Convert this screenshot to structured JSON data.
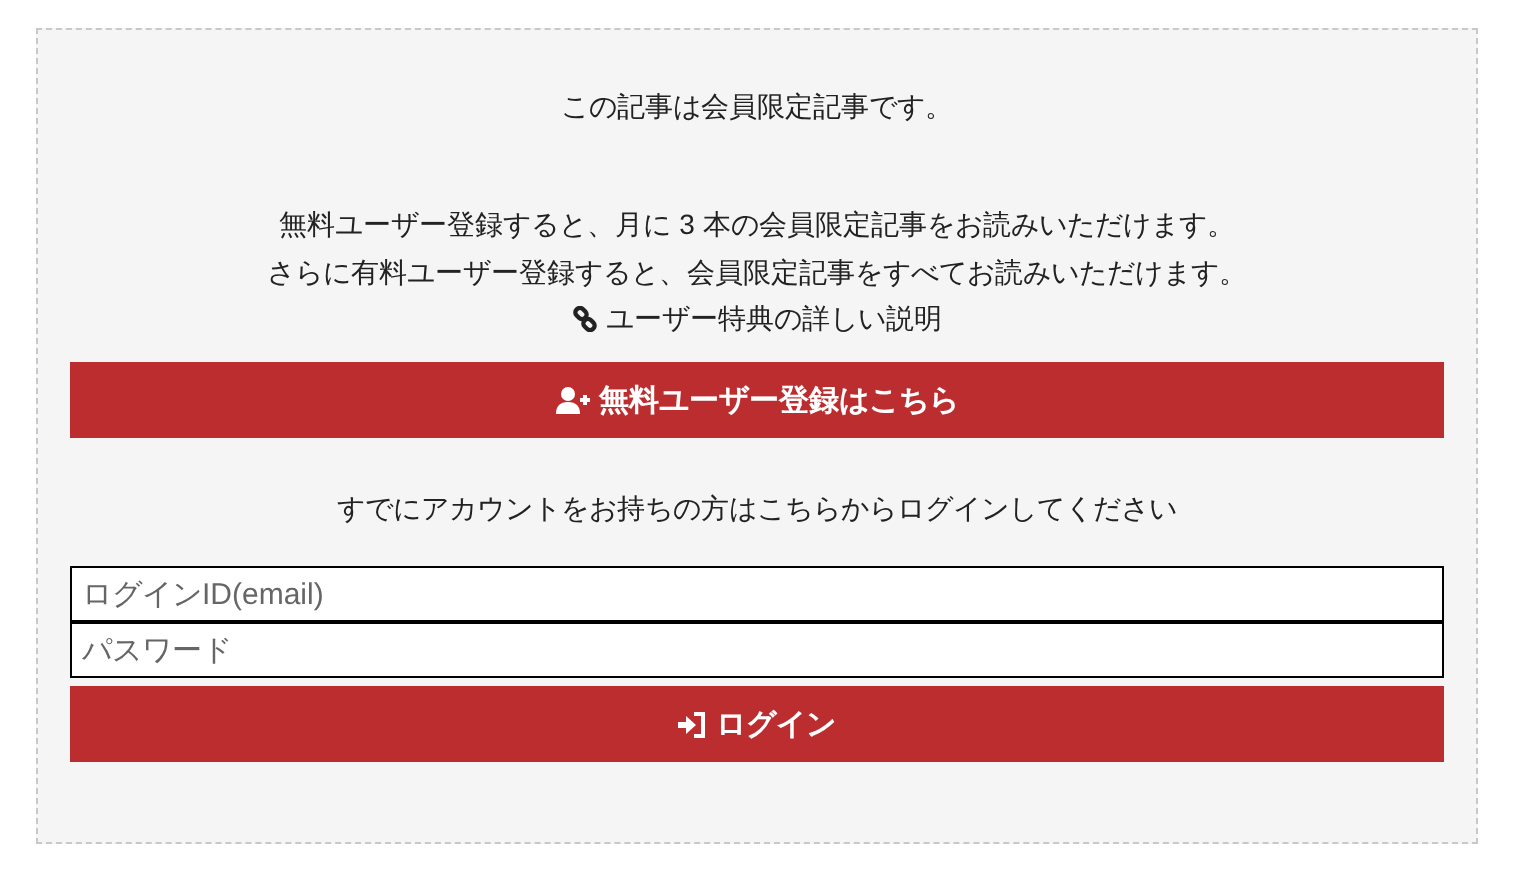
{
  "notice": {
    "title": "この記事は会員限定記事です。",
    "lines": [
      "無料ユーザー登録すると、月に 3 本の会員限定記事をお読みいただけます。",
      "さらに有料ユーザー登録すると、会員限定記事をすべてお読みいただけます。"
    ],
    "benefits_link": "ユーザー特典の詳しい説明"
  },
  "register_button": "無料ユーザー登録はこちら",
  "login_prompt": "すでにアカウントをお持ちの方はこちらからログインしてください",
  "login_form": {
    "fields": [
      {
        "placeholder": "ログインID(email)"
      },
      {
        "placeholder": "パスワード"
      }
    ],
    "button": "ログイン"
  }
}
